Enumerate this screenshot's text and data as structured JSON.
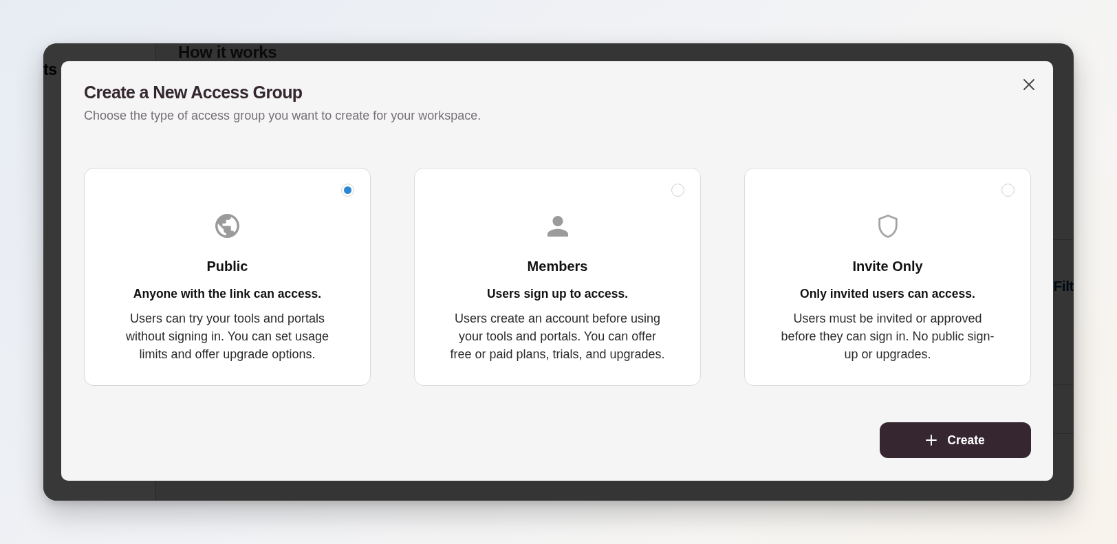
{
  "background": {
    "sidebar_text": "ts",
    "heading": "How it works",
    "toolbar_link": "Filt"
  },
  "dialog": {
    "title": "Create a New Access Group",
    "subtitle": "Choose the type of access group you want to create for your workspace.",
    "options": [
      {
        "kind": "public",
        "title": "Public",
        "tagline": "Anyone with the link can access.",
        "description": "Users can try your tools and portals without signing in. You can set usage limits and offer upgrade options.",
        "selected": true
      },
      {
        "kind": "members",
        "title": "Members",
        "tagline": "Users sign up to access.",
        "description": "Users create an account before using your tools and portals. You can offer free or paid plans, trials, and upgrades.",
        "selected": false
      },
      {
        "kind": "invite",
        "title": "Invite Only",
        "tagline": "Only invited users can access.",
        "description": "Users must be invited or approved before they can sign in. No public sign-up or upgrades.",
        "selected": false
      }
    ],
    "create_button": {
      "label": "Create"
    }
  }
}
